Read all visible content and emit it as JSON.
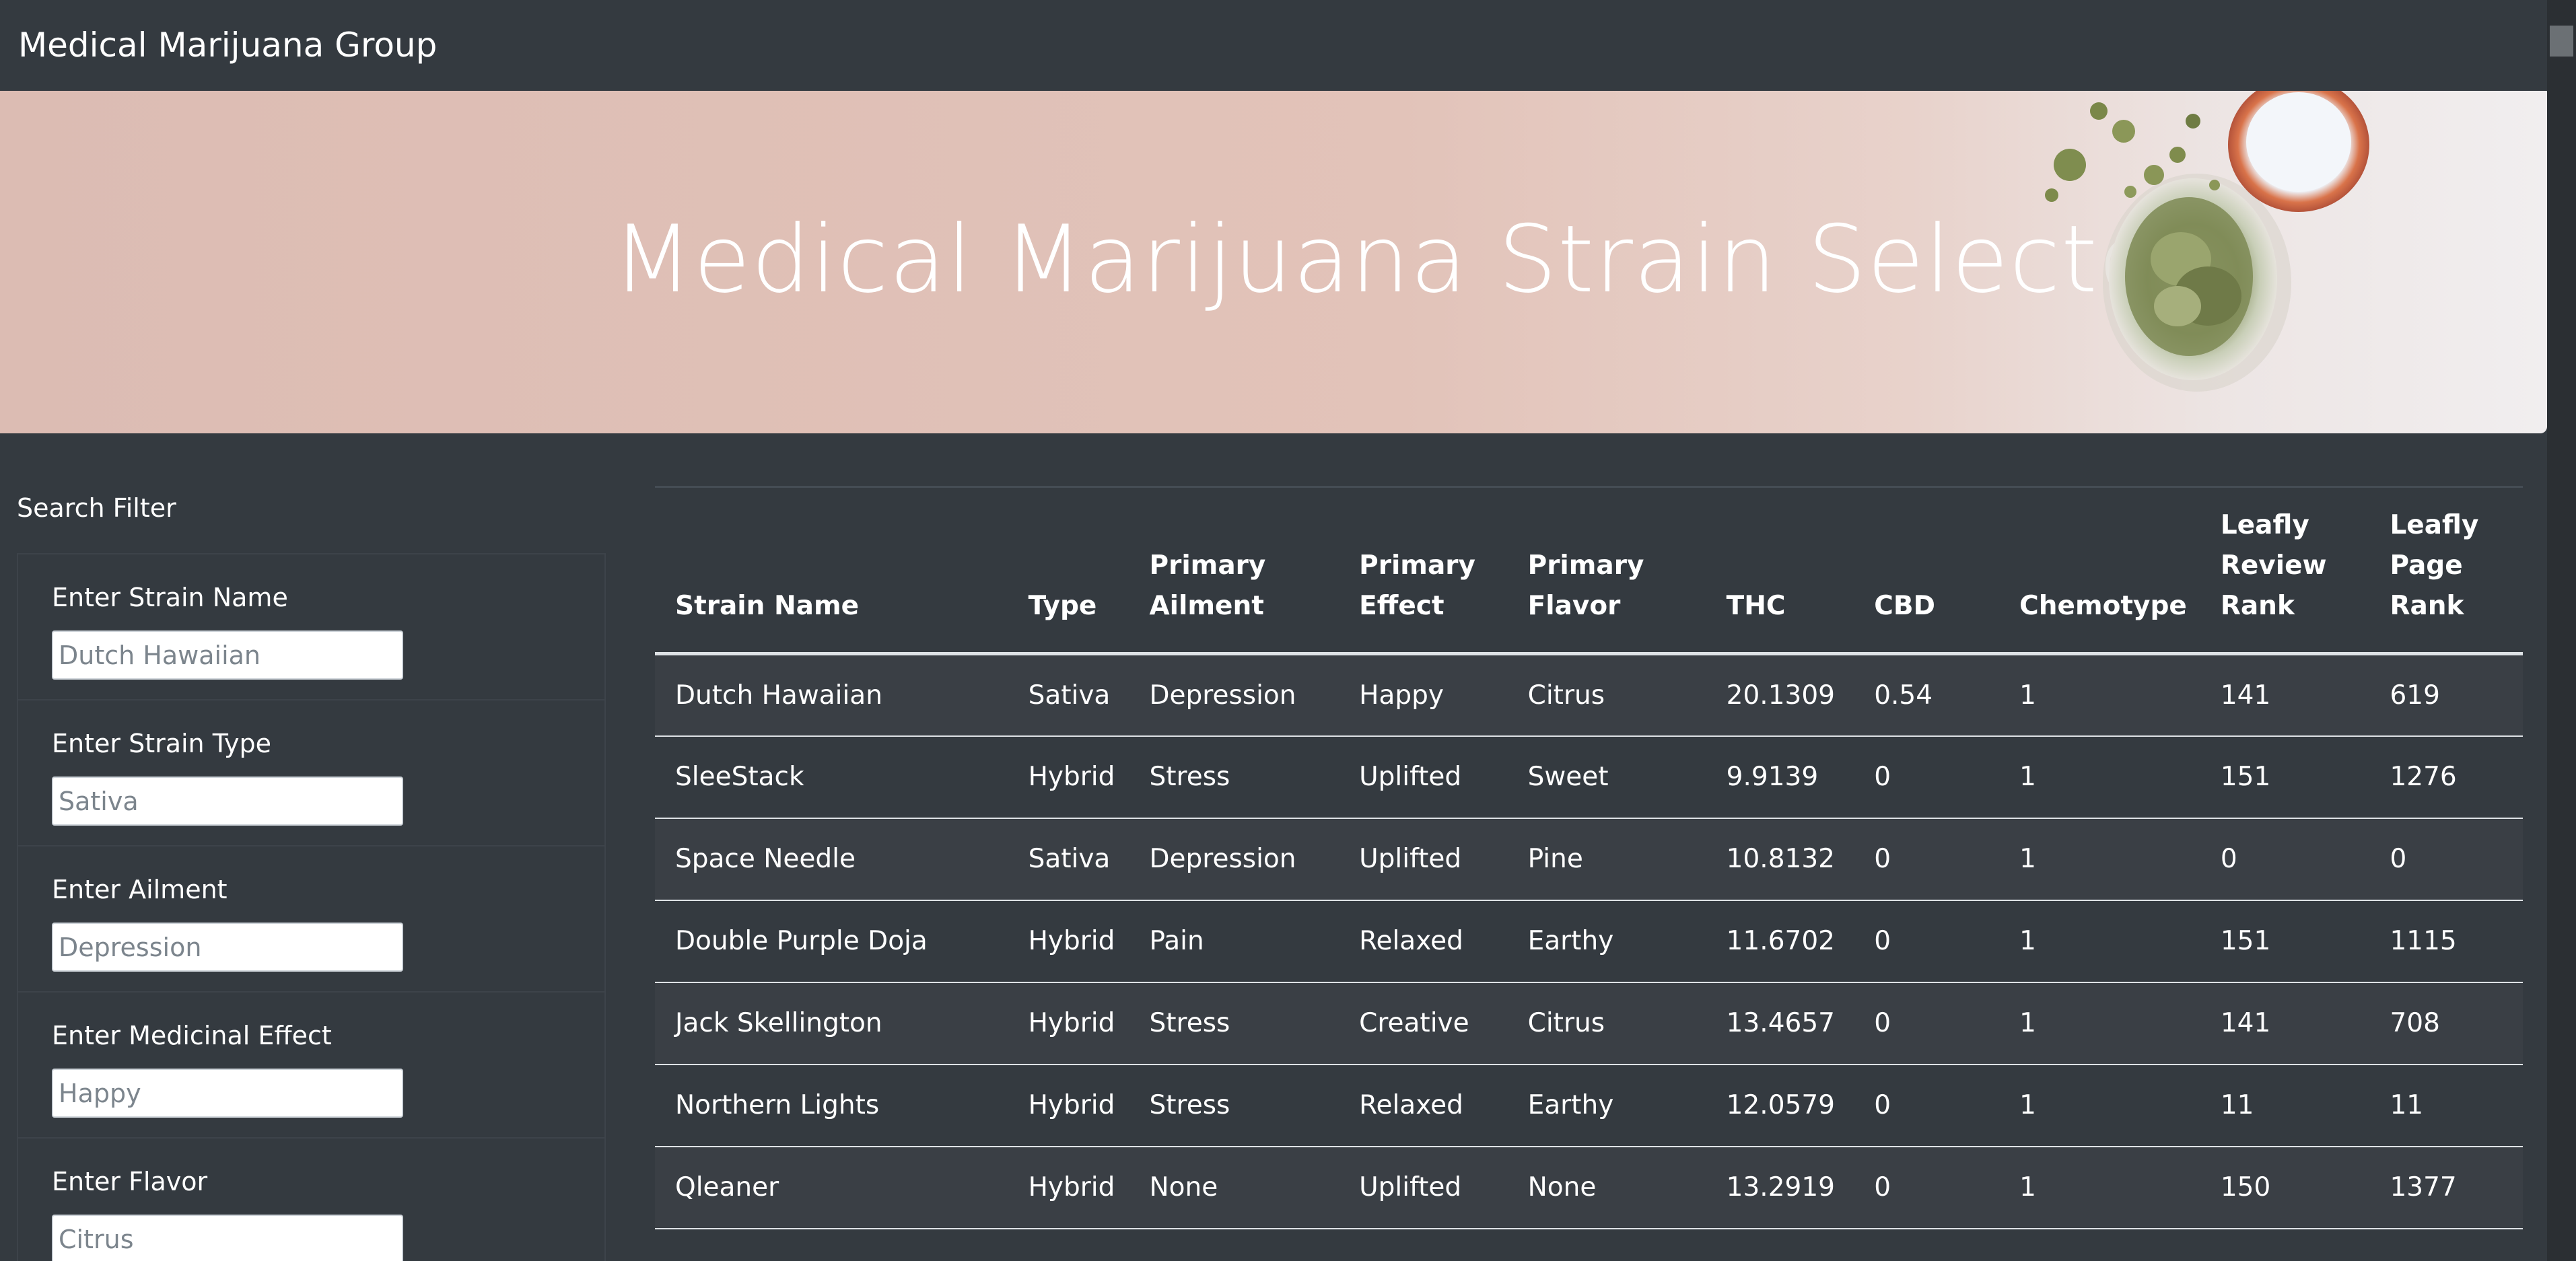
{
  "navbar": {
    "brand": "Medical Marijuana Group"
  },
  "hero": {
    "title": "Medical Marijuana Strain Selector"
  },
  "sidebar": {
    "heading": "Search Filter",
    "filters": [
      {
        "label": "Enter Strain Name",
        "placeholder": "Dutch Hawaiian"
      },
      {
        "label": "Enter Strain Type",
        "placeholder": "Sativa"
      },
      {
        "label": "Enter Ailment",
        "placeholder": "Depression"
      },
      {
        "label": "Enter Medicinal Effect",
        "placeholder": "Happy"
      },
      {
        "label": "Enter Flavor",
        "placeholder": "Citrus"
      }
    ]
  },
  "table": {
    "headers": [
      "Strain Name",
      "Type",
      "Primary Ailment",
      "Primary Effect",
      "Primary Flavor",
      "THC",
      "CBD",
      "Chemotype",
      "Leafly Review Rank",
      "Leafly Page Rank"
    ],
    "rows": [
      [
        "Dutch Hawaiian",
        "Sativa",
        "Depression",
        "Happy",
        "Citrus",
        "20.1309",
        "0.54",
        "1",
        "141",
        "619"
      ],
      [
        "SleeStack",
        "Hybrid",
        "Stress",
        "Uplifted",
        "Sweet",
        "9.9139",
        "0",
        "1",
        "151",
        "1276"
      ],
      [
        "Space Needle",
        "Sativa",
        "Depression",
        "Uplifted",
        "Pine",
        "10.8132",
        "0",
        "1",
        "0",
        "0"
      ],
      [
        "Double Purple Doja",
        "Hybrid",
        "Pain",
        "Relaxed",
        "Earthy",
        "11.6702",
        "0",
        "1",
        "151",
        "1115"
      ],
      [
        "Jack Skellington",
        "Hybrid",
        "Stress",
        "Creative",
        "Citrus",
        "13.4657",
        "0",
        "1",
        "141",
        "708"
      ],
      [
        "Northern Lights",
        "Hybrid",
        "Stress",
        "Relaxed",
        "Earthy",
        "12.0579",
        "0",
        "1",
        "11",
        "11"
      ],
      [
        "Qleaner",
        "Hybrid",
        "None",
        "Uplifted",
        "None",
        "13.2919",
        "0",
        "1",
        "150",
        "1377"
      ]
    ]
  },
  "colors": {
    "background": "#343a40",
    "hero_pink": "#dcbcb3",
    "row_stripe": "#3a3f45"
  }
}
